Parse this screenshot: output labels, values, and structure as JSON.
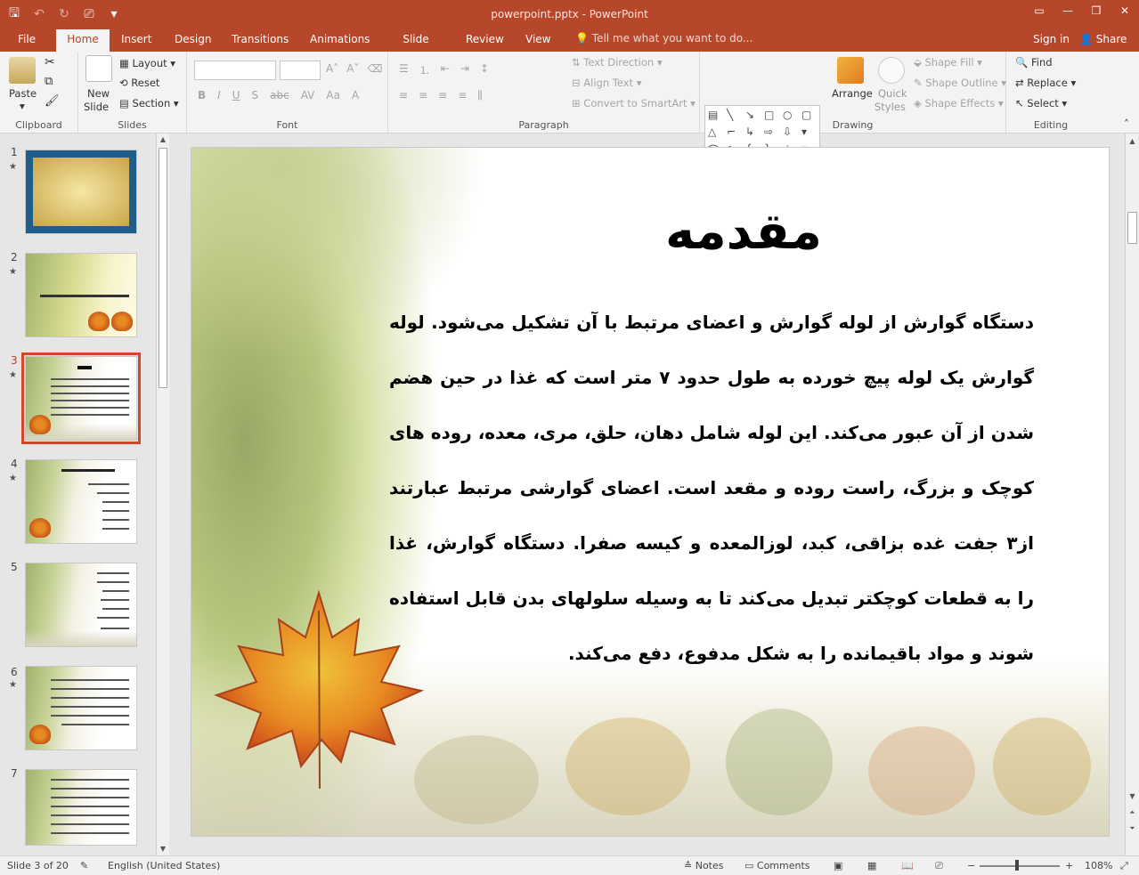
{
  "window": {
    "title": "powerpoint.pptx - PowerPoint",
    "qat": {
      "save_icon": "save-icon",
      "undo_icon": "undo-icon",
      "redo_icon": "redo-icon",
      "present_icon": "present-icon"
    }
  },
  "tabs": [
    {
      "label": "File"
    },
    {
      "label": "Home"
    },
    {
      "label": "Insert"
    },
    {
      "label": "Design"
    },
    {
      "label": "Transitions"
    },
    {
      "label": "Animations"
    },
    {
      "label": "Slide Show"
    },
    {
      "label": "Review"
    },
    {
      "label": "View"
    }
  ],
  "tell_me": "Tell me what you want to do...",
  "sign_in": "Sign in",
  "share": "Share",
  "ribbon": {
    "clipboard": {
      "label": "Clipboard",
      "paste": "Paste"
    },
    "slides": {
      "label": "Slides",
      "new_slide_1": "New",
      "new_slide_2": "Slide",
      "layout": "Layout",
      "reset": "Reset",
      "section": "Section"
    },
    "font": {
      "label": "Font"
    },
    "paragraph": {
      "label": "Paragraph",
      "text_direction": "Text Direction",
      "align_text": "Align Text",
      "smartart": "Convert to SmartArt"
    },
    "drawing": {
      "label": "Drawing",
      "arrange": "Arrange",
      "quick_styles_1": "Quick",
      "quick_styles_2": "Styles",
      "shape_fill": "Shape Fill",
      "shape_outline": "Shape Outline",
      "shape_effects": "Shape Effects"
    },
    "editing": {
      "label": "Editing",
      "find": "Find",
      "replace": "Replace",
      "select": "Select"
    }
  },
  "thumbnails": [
    {
      "num": "1",
      "star": "★"
    },
    {
      "num": "2",
      "star": "★"
    },
    {
      "num": "3",
      "star": "★"
    },
    {
      "num": "4",
      "star": "★"
    },
    {
      "num": "5",
      "star": ""
    },
    {
      "num": "6",
      "star": "★"
    },
    {
      "num": "7",
      "star": ""
    }
  ],
  "slide": {
    "title": "مقدمه",
    "body": "دستگاه گوارش از لوله گوارش و اعضای مرتبط با آن تشکیل می‌شود. لوله گوارش یک لوله پیچ خورده به طول حدود ۷ متر است که غذا در حین هضم شدن از آن عبور می‌کند. این لوله شامل دهان، حلق، مری، معده، روده های کوچک و بزرگ، راست روده و مقعد است. اعضای گوارشی مرتبط عبارتند از۳ جفت غده بزاقی، کبد، لوزالمعده و کیسه صفرا. دستگاه گوارش، غذا را به قطعات کوچکتر تبدیل می‌کند تا به وسیله سلولهای بدن قابل استفاده شوند و مواد باقیمانده را به شکل مدفوع، دفع می‌کند."
  },
  "status": {
    "slide_of": "Slide 3 of 20",
    "language": "English (United States)",
    "notes": "Notes",
    "comments": "Comments",
    "zoom": "108%"
  }
}
